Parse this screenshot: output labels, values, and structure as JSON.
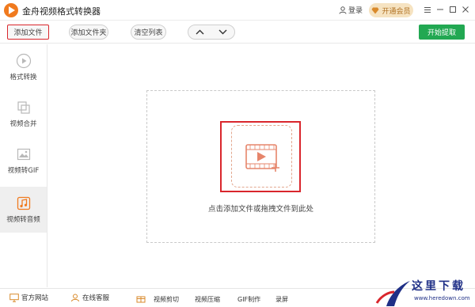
{
  "app": {
    "title": "金舟视频格式转换器",
    "login": "登录",
    "vip": "开通会员"
  },
  "toolbar": {
    "add_file": "添加文件",
    "add_folder": "添加文件夹",
    "clear_list": "清空列表",
    "start": "开始提取"
  },
  "sidebar": {
    "items": [
      {
        "label": "格式转换",
        "icon": "play-circle-icon"
      },
      {
        "label": "视频合并",
        "icon": "merge-icon"
      },
      {
        "label": "视频转GIF",
        "icon": "image-icon"
      },
      {
        "label": "视频转音频",
        "icon": "music-note-icon",
        "active": true
      }
    ]
  },
  "main": {
    "drop_text": "点击添加文件或拖拽文件到此处"
  },
  "footer": {
    "official_site": "官方网站",
    "online_service": "在线客服",
    "video_cut": "视频剪切",
    "video_compress": "视频压缩",
    "gif_make": "GIF制作",
    "record": "录屏"
  },
  "watermark": {
    "text": "这里下载",
    "url": "www.heredown.com"
  },
  "colors": {
    "accent": "#f07a1f",
    "start": "#22a852",
    "highlight": "#d9262c",
    "vip_bg": "#f6e3c1"
  }
}
